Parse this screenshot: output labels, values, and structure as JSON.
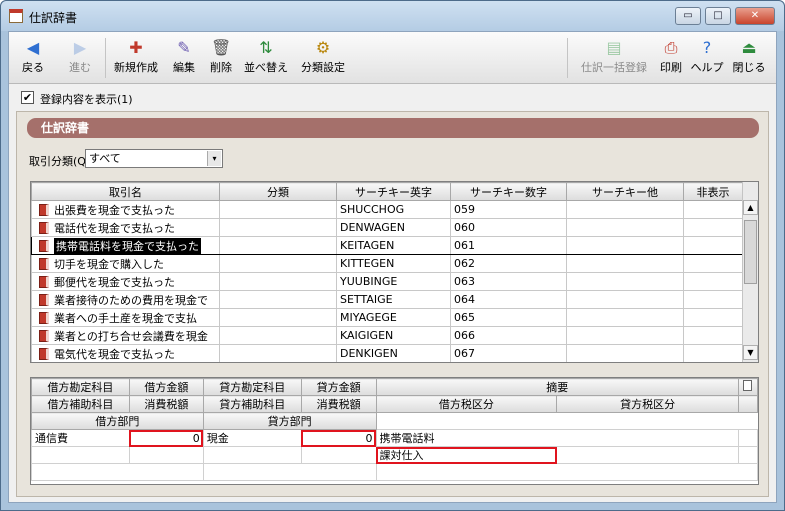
{
  "window": {
    "title": "仕訳辞書",
    "min_glyph": "▭",
    "max_glyph": "□",
    "close_glyph": "✕"
  },
  "toolbar": {
    "left": [
      {
        "id": "back",
        "label": "戻る",
        "icon": "back-arrow-icon",
        "glyph": "◀",
        "color": "#2f6fd1",
        "disabled": false
      },
      {
        "id": "forward",
        "label": "進む",
        "icon": "forward-arrow-icon",
        "glyph": "▶",
        "color": "#7aa0d8",
        "disabled": true
      },
      {
        "id": "new",
        "label": "新規作成",
        "icon": "new-document-icon",
        "glyph": "✚",
        "color": "#c0392b",
        "disabled": false
      },
      {
        "id": "edit",
        "label": "編集",
        "icon": "edit-pencil-icon",
        "glyph": "✎",
        "color": "#6b5bb0",
        "disabled": false
      },
      {
        "id": "delete",
        "label": "削除",
        "icon": "trash-icon",
        "glyph": "🗑",
        "color": "#555555",
        "disabled": false
      },
      {
        "id": "sort",
        "label": "並べ替え",
        "icon": "sort-icon",
        "glyph": "⇅",
        "color": "#2e8b3d",
        "disabled": false
      },
      {
        "id": "category",
        "label": "分類設定",
        "icon": "category-settings-icon",
        "glyph": "⚙",
        "color": "#b8860b",
        "disabled": false
      }
    ],
    "right": [
      {
        "id": "bulk-register",
        "label": "仕訳一括登録",
        "icon": "bulk-register-icon",
        "glyph": "▤",
        "color": "#3a9a4a",
        "disabled": true
      },
      {
        "id": "print",
        "label": "印刷",
        "icon": "printer-icon",
        "glyph": "⎙",
        "color": "#c0392b",
        "disabled": false
      },
      {
        "id": "help",
        "label": "ヘルプ",
        "icon": "help-icon",
        "glyph": "?",
        "color": "#2f6fd1",
        "disabled": false
      },
      {
        "id": "close",
        "label": "閉じる",
        "icon": "exit-icon",
        "glyph": "⏏",
        "color": "#2e8b3d",
        "disabled": false
      }
    ]
  },
  "options": {
    "show_registration": {
      "label": "登録内容を表示(1)",
      "checked": true,
      "check_glyph": "✔"
    }
  },
  "section": {
    "title": "仕訳辞書"
  },
  "filter": {
    "label": "取引分類(Q):",
    "selected": "すべて",
    "arrow_glyph": "▾"
  },
  "grid": {
    "columns": [
      "取引名",
      "分類",
      "サーチキー英字",
      "サーチキー数字",
      "サーチキー他",
      "非表示"
    ],
    "rows": [
      {
        "name": "出張費を現金で支払った",
        "category": "",
        "key_alpha": "SHUCCHOG",
        "key_num": "059",
        "key_other": "",
        "hidden": ""
      },
      {
        "name": "電話代を現金で支払った",
        "category": "",
        "key_alpha": "DENWAGEN",
        "key_num": "060",
        "key_other": "",
        "hidden": ""
      },
      {
        "name": "携帯電話料を現金で支払った",
        "category": "",
        "key_alpha": "KEITAGEN",
        "key_num": "061",
        "key_other": "",
        "hidden": "",
        "selected": true
      },
      {
        "name": "切手を現金で購入した",
        "category": "",
        "key_alpha": "KITTEGEN",
        "key_num": "062",
        "key_other": "",
        "hidden": ""
      },
      {
        "name": "郵便代を現金で支払った",
        "category": "",
        "key_alpha": "YUUBINGE",
        "key_num": "063",
        "key_other": "",
        "hidden": ""
      },
      {
        "name": "業者接待のための費用を現金で",
        "category": "",
        "key_alpha": "SETTAIGE",
        "key_num": "064",
        "key_other": "",
        "hidden": ""
      },
      {
        "name": "業者への手土産を現金で支払",
        "category": "",
        "key_alpha": "MIYAGEGE",
        "key_num": "065",
        "key_other": "",
        "hidden": ""
      },
      {
        "name": "業者との打ち合せ会議費を現金",
        "category": "",
        "key_alpha": "KAIGIGEN",
        "key_num": "066",
        "key_other": "",
        "hidden": ""
      },
      {
        "name": "電気代を現金で支払った",
        "category": "",
        "key_alpha": "DENKIGEN",
        "key_num": "067",
        "key_other": "",
        "hidden": ""
      }
    ],
    "scroll_up_glyph": "▲",
    "scroll_down_glyph": "▼"
  },
  "detail": {
    "header_row1": [
      "借方勘定科目",
      "借方金額",
      "貸方勘定科目",
      "貸方金額",
      "摘要"
    ],
    "header_row2": [
      "借方補助科目",
      "消費税額",
      "貸方補助科目",
      "消費税額",
      "借方税区分",
      "貸方税区分"
    ],
    "header_row3": [
      "借方部門",
      "貸方部門"
    ],
    "entry": {
      "debit_account": "通信費",
      "debit_amount": "0",
      "credit_account": "現金",
      "credit_amount": "0",
      "memo": "携帯電話料",
      "debit_tax_class": "課対仕入"
    }
  }
}
